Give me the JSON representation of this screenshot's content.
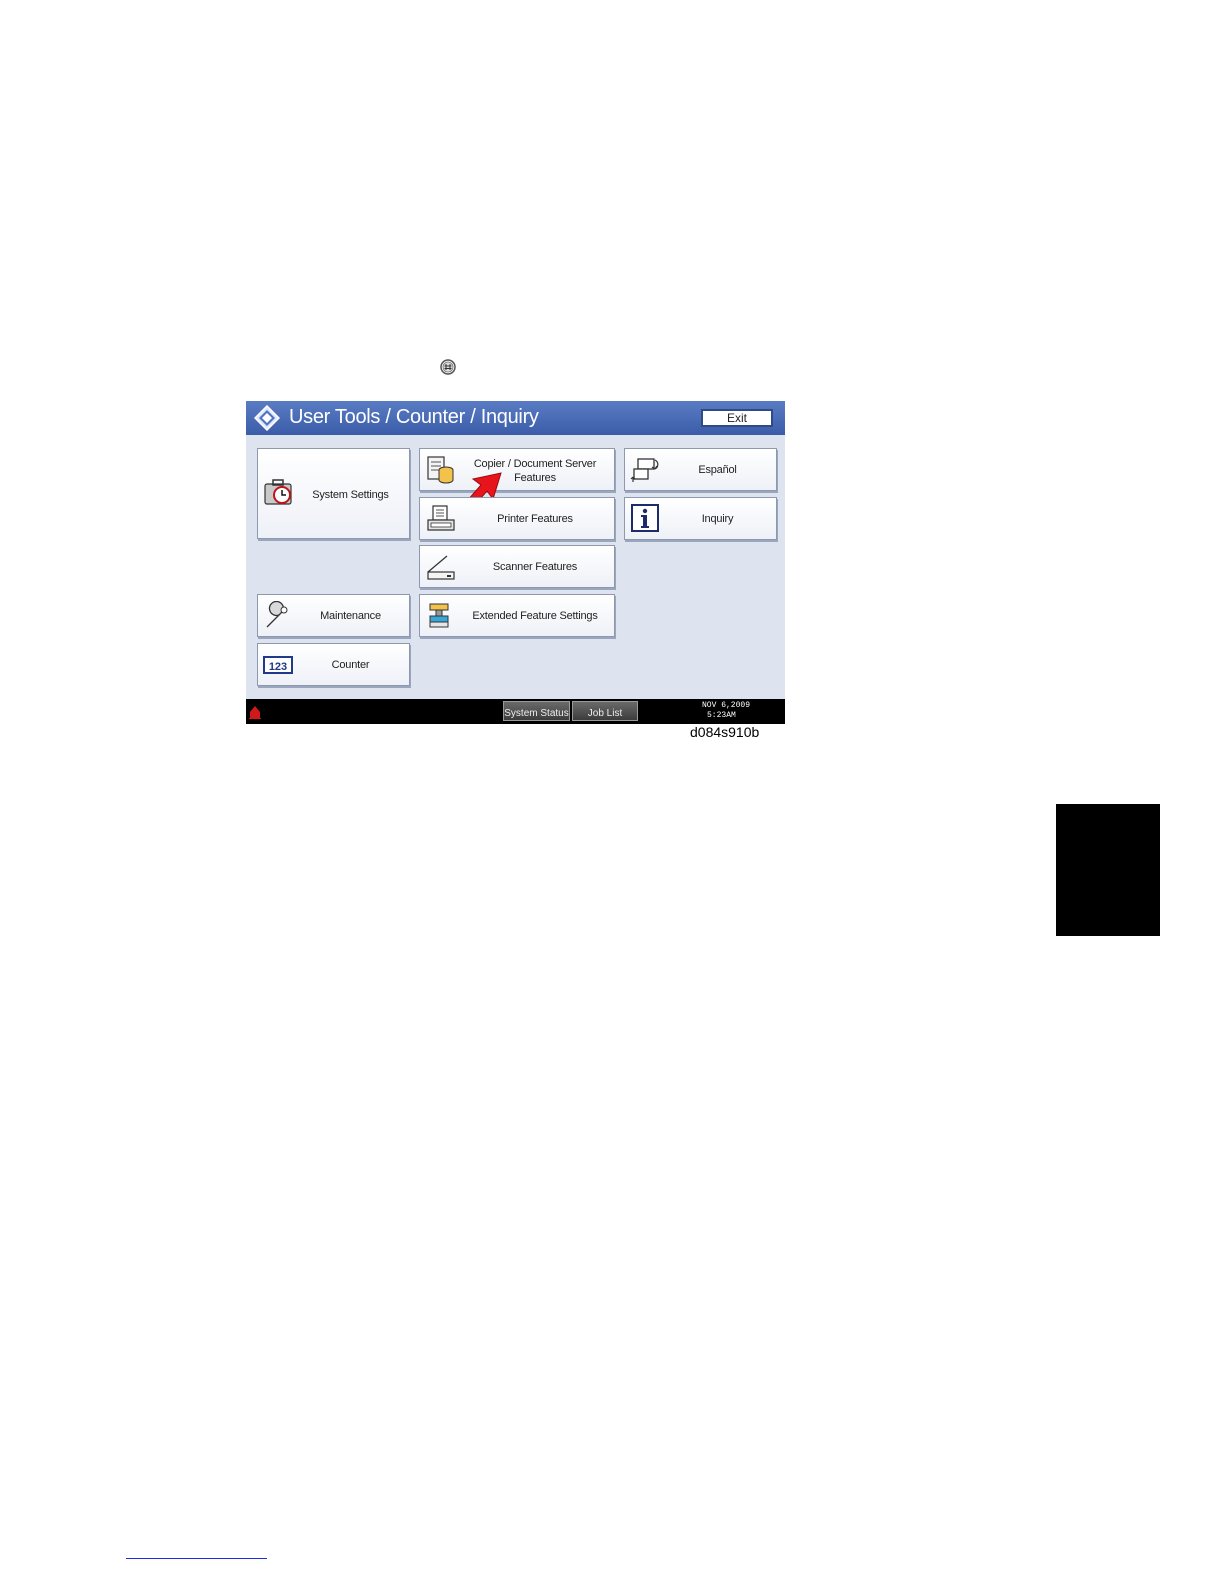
{
  "header": {
    "title": "User Tools / Counter / Inquiry",
    "exit_label": "Exit"
  },
  "menu": {
    "system_settings": "System Settings",
    "copier_line1": "Copier / Document Server",
    "copier_line2": "Features",
    "printer_features": "Printer Features",
    "scanner_features": "Scanner Features",
    "extended_feature_settings": "Extended Feature Settings",
    "maintenance": "Maintenance",
    "counter": "Counter",
    "espanol": "Español",
    "inquiry": "Inquiry"
  },
  "statusbar": {
    "system_status": "System Status",
    "job_list": "Job List",
    "date": "NOV   6,2009",
    "time": "5:23AM"
  },
  "figure": {
    "label": "d084s910b"
  },
  "colors": {
    "title_bar": "#3b5ca8",
    "panel_bg": "#dde3ef",
    "arrow": "#e8141b"
  }
}
